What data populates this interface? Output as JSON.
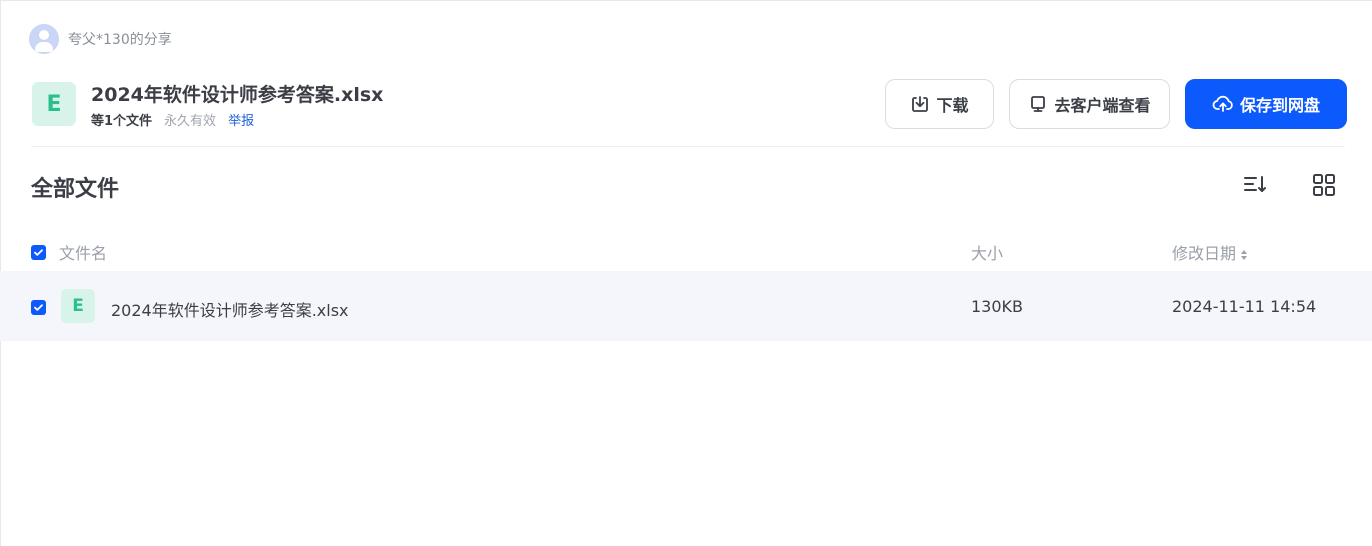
{
  "sharer": {
    "name": "夸父*130的分享"
  },
  "file": {
    "badge_letter": "E",
    "title": "2024年软件设计师参考答案.xlsx",
    "count_text": "等1个文件",
    "validity": "永久有效",
    "report": "举报"
  },
  "actions": {
    "download": "下载",
    "open_client": "去客户端查看",
    "save": "保存到网盘"
  },
  "section": {
    "title": "全部文件"
  },
  "table": {
    "columns": {
      "name": "文件名",
      "size": "大小",
      "date": "修改日期"
    },
    "rows": [
      {
        "badge_letter": "E",
        "name": "2024年软件设计师参考答案.xlsx",
        "size": "130KB",
        "date": "2024-11-11 14:54",
        "checked": true
      }
    ]
  },
  "colors": {
    "primary": "#0d5afc",
    "excel_green": "#2bbf8b",
    "row_highlight": "#f5f6fc"
  },
  "icons": [
    "user-avatar-icon",
    "excel-file-icon",
    "download-icon",
    "monitor-icon",
    "cloud-upload-icon",
    "sort-icon",
    "grid-view-icon",
    "checkbox-checked-icon",
    "sort-arrows-icon"
  ]
}
